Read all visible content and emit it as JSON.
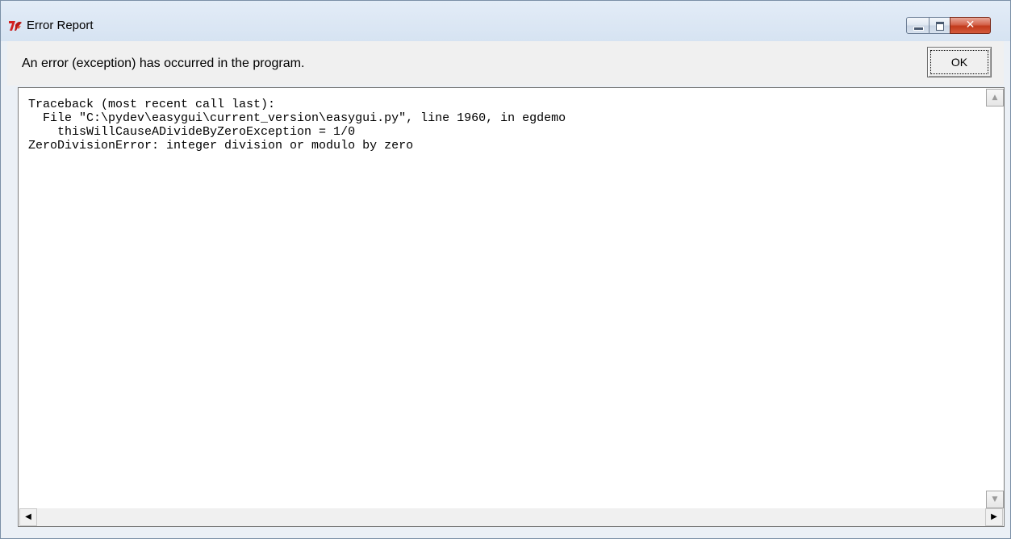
{
  "window": {
    "title": "Error Report",
    "app_icon": "python-feather-icon",
    "controls": {
      "minimize_icon": "minimize-icon",
      "maximize_icon": "maximize-icon",
      "close_icon": "close-icon",
      "close_glyph": "✕"
    },
    "colors": {
      "close_button": "#c23a1c",
      "titlebar": "#d6e3f2"
    }
  },
  "header": {
    "message": "An error (exception) has occurred in the program.",
    "ok_label": "OK"
  },
  "traceback": {
    "text": "Traceback (most recent call last):\n  File \"C:\\pydev\\easygui\\current_version\\easygui.py\", line 1960, in egdemo\n    thisWillCauseADivideByZeroException = 1/0\nZeroDivisionError: integer division or modulo by zero"
  },
  "scrollbars": {
    "up_arrow": "▲",
    "down_arrow": "▼",
    "left_arrow": "◀",
    "right_arrow": "▶"
  }
}
